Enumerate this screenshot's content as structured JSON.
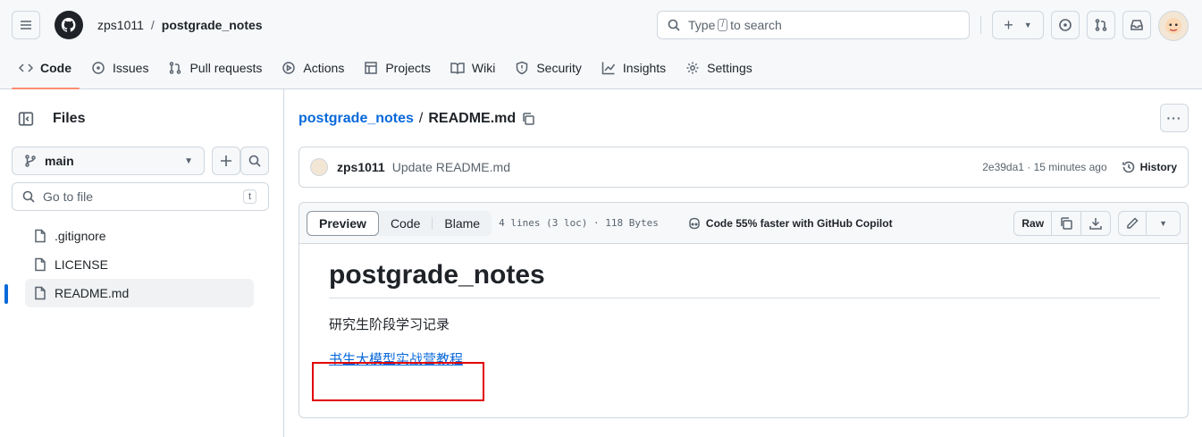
{
  "header": {
    "owner": "zps1011",
    "separator": "/",
    "repo": "postgrade_notes",
    "search_prefix": "Type",
    "search_key": "/",
    "search_suffix": "to search"
  },
  "tabs": [
    {
      "label": "Code",
      "icon": "code-icon"
    },
    {
      "label": "Issues",
      "icon": "issue-icon"
    },
    {
      "label": "Pull requests",
      "icon": "pull-request-icon"
    },
    {
      "label": "Actions",
      "icon": "play-icon"
    },
    {
      "label": "Projects",
      "icon": "table-icon"
    },
    {
      "label": "Wiki",
      "icon": "book-icon"
    },
    {
      "label": "Security",
      "icon": "shield-icon"
    },
    {
      "label": "Insights",
      "icon": "graph-icon"
    },
    {
      "label": "Settings",
      "icon": "gear-icon"
    }
  ],
  "sidebar": {
    "title": "Files",
    "branch": "main",
    "goto_placeholder": "Go to file",
    "goto_key": "t",
    "files": [
      ".gitignore",
      "LICENSE",
      "README.md"
    ]
  },
  "file": {
    "repo_link": "postgrade_notes",
    "separator": "/",
    "name": "README.md"
  },
  "commit": {
    "author": "zps1011",
    "message": "Update README.md",
    "meta": "2e39da1 · 15 minutes ago",
    "history_label": "History"
  },
  "viewer": {
    "preview": "Preview",
    "code": "Code",
    "blame": "Blame",
    "lines_info": "4 lines (3 loc) · 118 Bytes",
    "copilot": "Code 55% faster with GitHub Copilot",
    "raw": "Raw"
  },
  "readme": {
    "heading": "postgrade_notes",
    "paragraph": "研究生阶段学习记录",
    "link": "书生大模型实战营教程"
  },
  "colors": {
    "accent": "#0969da",
    "tab_underline": "#fd8c73",
    "highlight_box": "#e00000"
  }
}
